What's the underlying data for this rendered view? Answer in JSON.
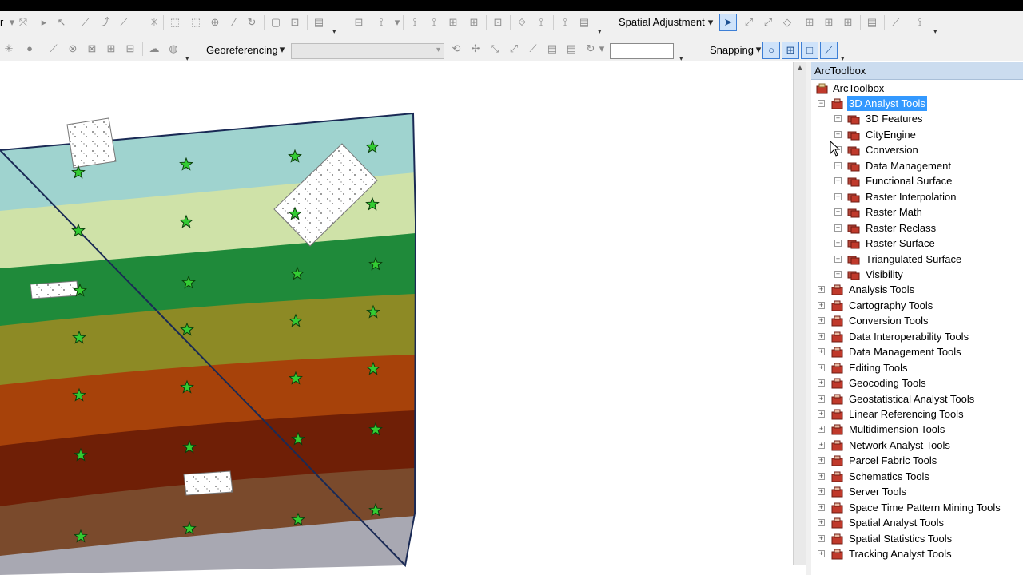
{
  "toolbars": {
    "row1": {
      "fragment_label": "r",
      "spatial_adjustment_label": "Spatial Adjustment"
    },
    "row2": {
      "georeferencing_label": "Georeferencing",
      "layer_combo_value": "",
      "rms_value": "",
      "snapping_label": "Snapping"
    }
  },
  "toolbox": {
    "title": "ArcToolbox",
    "root": "ArcToolbox",
    "expanded": {
      "label": "3D Analyst Tools",
      "children": [
        "3D Features",
        "CityEngine",
        "Conversion",
        "Data Management",
        "Functional Surface",
        "Raster Interpolation",
        "Raster Math",
        "Raster Reclass",
        "Raster Surface",
        "Triangulated Surface",
        "Visibility"
      ]
    },
    "toolboxes": [
      "Analysis Tools",
      "Cartography Tools",
      "Conversion Tools",
      "Data Interoperability Tools",
      "Data Management Tools",
      "Editing Tools",
      "Geocoding Tools",
      "Geostatistical Analyst Tools",
      "Linear Referencing Tools",
      "Multidimension Tools",
      "Network Analyst Tools",
      "Parcel Fabric Tools",
      "Schematics Tools",
      "Server Tools",
      "Space Time Pattern Mining Tools",
      "Spatial Analyst Tools",
      "Spatial Statistics Tools",
      "Tracking Analyst Tools"
    ]
  },
  "map": {
    "bands": [
      "#9fd3cf",
      "#cfe2a8",
      "#1f8a3a",
      "#8d8a25",
      "#a7420a",
      "#6f1f06",
      "#7a4a2c",
      "#a8a8b2"
    ],
    "star_color": "#33cc33"
  }
}
